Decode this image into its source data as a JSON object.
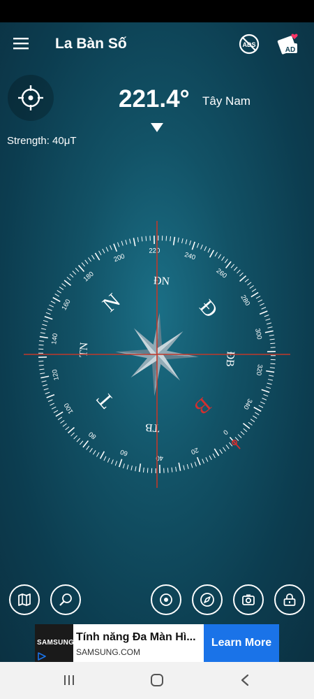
{
  "app": {
    "title": "La Bàn Số",
    "heading_value": "221.4°",
    "direction_label": "Tây Nam",
    "strength_label": "Strength: 40μT"
  },
  "icons": {
    "menu": "menu-icon",
    "no_ads": "no-ads-icon",
    "reward_ad": "reward-ad-icon",
    "location": "crosshair-icon",
    "map": "map-icon",
    "zoom": "zoom-icon",
    "target": "target-icon",
    "navigation": "navigation-icon",
    "camera": "camera-icon",
    "lock": "lock-icon"
  },
  "topbar": {
    "no_ads_text": "ADS",
    "reward_ad_text": "AD"
  },
  "compass": {
    "heading_deg": 221.4,
    "degree_labels": [
      "0",
      "20",
      "40",
      "60",
      "80",
      "100",
      "120",
      "140",
      "160",
      "180",
      "200",
      "220",
      "240",
      "260",
      "280",
      "300",
      "320",
      "340"
    ],
    "cardinals": [
      {
        "label": "N",
        "angle": 180
      },
      {
        "label": "Đ",
        "angle": 270
      },
      {
        "label": "B",
        "angle": 0,
        "highlight": true
      },
      {
        "label": "T",
        "angle": 90
      }
    ],
    "intercardinals": [
      {
        "label": "TN",
        "angle": 135
      },
      {
        "label": "TB",
        "angle": 45
      },
      {
        "label": "ĐB",
        "angle": 315
      },
      {
        "label": "ĐN",
        "angle": 225
      }
    ]
  },
  "ad": {
    "brand": "SAMSUNG",
    "headline": "Tính năng Đa Màn Hì...",
    "domain": "SAMSUNG.COM",
    "cta": "Learn More"
  },
  "colors": {
    "background": "#125266",
    "accent_red": "#d32f2f",
    "ad_button": "#1a73e8"
  }
}
